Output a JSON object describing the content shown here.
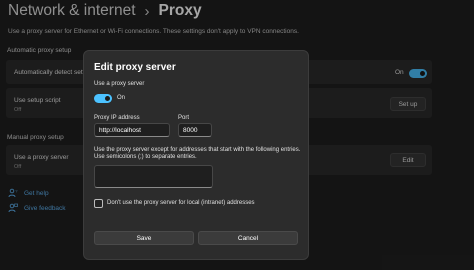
{
  "header": {
    "breadcrumb_parent": "Network & internet",
    "breadcrumb_separator": "›",
    "breadcrumb_current": "Proxy",
    "description": "Use a proxy server for Ethernet or Wi-Fi connections. These settings don't apply to VPN connections."
  },
  "automatic_setup": {
    "section_title": "Automatic proxy setup",
    "detect_label": "Automatically detect settings",
    "detect_state": "On",
    "script_label": "Use setup script",
    "script_state": "Off",
    "script_button": "Set up"
  },
  "manual_setup": {
    "section_title": "Manual proxy setup",
    "use_proxy_label": "Use a proxy server",
    "use_proxy_state": "Off",
    "edit_button": "Edit"
  },
  "help_links": [
    {
      "label": "Get help",
      "icon": "help-person-icon"
    },
    {
      "label": "Give feedback",
      "icon": "feedback-person-icon"
    }
  ],
  "dialog": {
    "title": "Edit proxy server",
    "use_proxy_label": "Use a proxy server",
    "toggle_state": "On",
    "ip_label": "Proxy IP address",
    "ip_value": "http://localhost",
    "port_label": "Port",
    "port_value": "8000",
    "exceptions_line1": "Use the proxy server except for addresses that start with the following entries.",
    "exceptions_line2": "Use semicolons (;) to separate entries.",
    "exceptions_value": "",
    "local_checkbox_label": "Don't use the proxy server for local (intranet) addresses",
    "local_checkbox_checked": false,
    "save_label": "Save",
    "cancel_label": "Cancel"
  },
  "colors": {
    "accent": "#4cc2ff",
    "link": "#5fb2f2",
    "background": "#202020",
    "dialog": "#2c2c2c"
  }
}
